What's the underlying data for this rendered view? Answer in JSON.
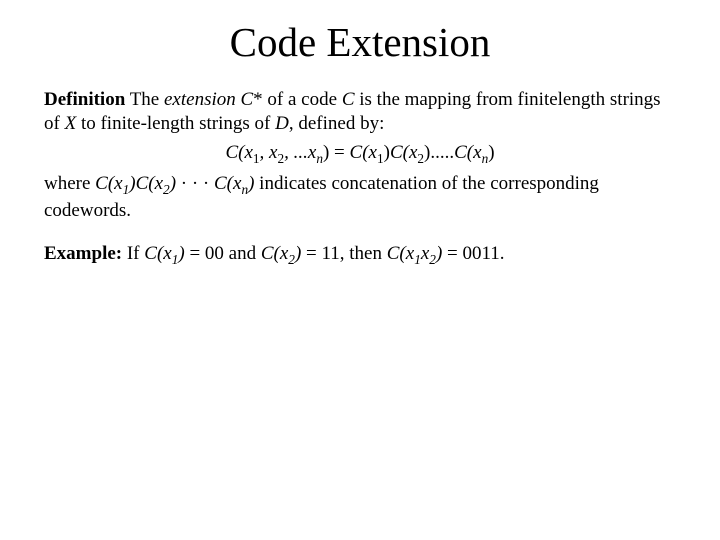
{
  "title": "Code Extension",
  "def": {
    "label": "Definition",
    "t1": " The ",
    "ext": "extension C",
    "star": "*",
    "t2": " of a code ",
    "C": "C",
    "t3": " is the mapping from finitelength strings of ",
    "X": "X",
    "t4": " to finite-length strings of ",
    "D": "D",
    "t5": ", defined by:"
  },
  "eq": {
    "lhs_C": "C(x",
    "comma_x": ", x",
    "dots": ", ...x",
    "rparen_eq": ") = ",
    "Cx": "C(x",
    "rparen": ")",
    "period": ".",
    "ell": "....",
    "s1": "1",
    "s2": "2",
    "sn": "n"
  },
  "concat": {
    "t1": "where ",
    "c1": "C(x",
    "s1": "1",
    "mid": ")C(x",
    "s2": "2",
    "close": ")",
    "dots": " · · · ",
    "cn": "C(x",
    "sn": "n",
    "t2": " indicates concatenation of the corresponding codewords."
  },
  "example": {
    "label": "Example:",
    "t1": " If ",
    "c1": "C(x",
    "s1": "1",
    "close": ")",
    "eq1": " = 00 and ",
    "c2": "C(x",
    "s2": "2",
    "eq2": " = 11, then ",
    "c12": "C(x",
    "s1b": "1",
    "x2": "x",
    "s2b": "2",
    "eq3": " = 0011."
  }
}
